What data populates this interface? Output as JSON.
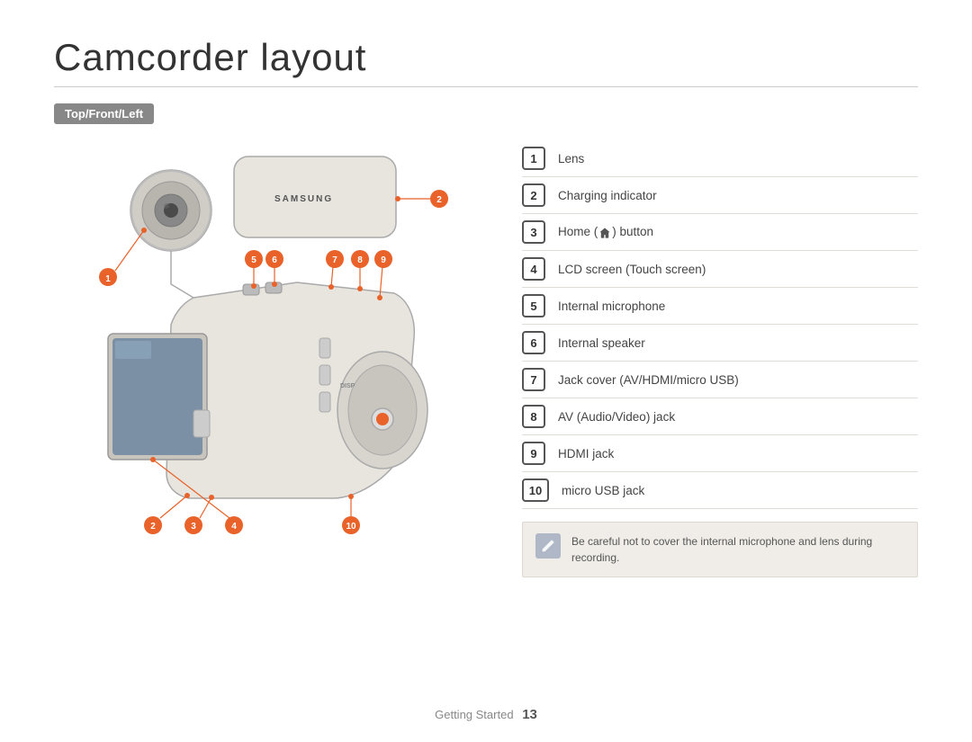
{
  "page": {
    "title": "Camcorder layout",
    "section_badge": "Top/Front/Left",
    "footer_text": "Getting Started",
    "page_number": "13"
  },
  "parts": [
    {
      "number": "1",
      "label": "Lens"
    },
    {
      "number": "2",
      "label": "Charging indicator"
    },
    {
      "number": "3",
      "label": "Home (  ) button"
    },
    {
      "number": "4",
      "label": "LCD screen (Touch screen)"
    },
    {
      "number": "5",
      "label": "Internal microphone"
    },
    {
      "number": "6",
      "label": "Internal speaker"
    },
    {
      "number": "7",
      "label": "Jack cover (AV/HDMI/micro USB)"
    },
    {
      "number": "8",
      "label": "AV (Audio/Video) jack"
    },
    {
      "number": "9",
      "label": "HDMI jack"
    },
    {
      "number": "10",
      "label": "micro USB jack"
    }
  ],
  "note": {
    "text": "Be careful not to cover the internal microphone and lens during recording."
  }
}
